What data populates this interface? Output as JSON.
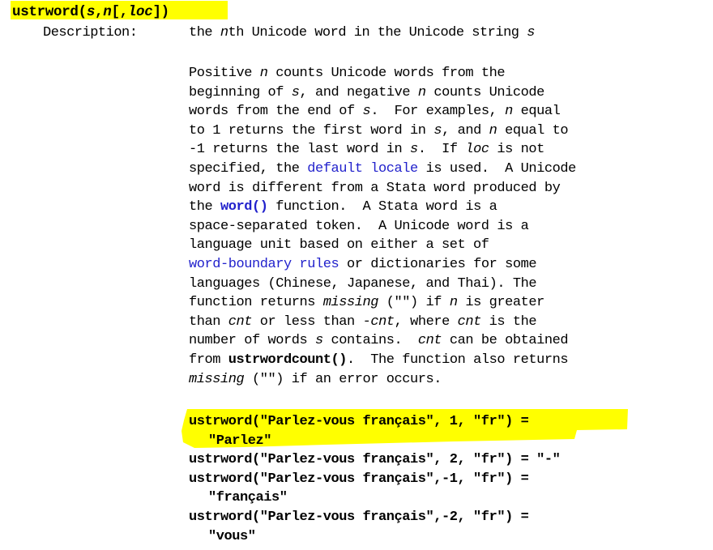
{
  "document": {
    "type": "stata-help-entry",
    "background_color": "#ffffff",
    "text_color": "#000000",
    "link_color": "#2222cc",
    "highlight_color": "#ffff00"
  },
  "signature": {
    "name": "ustrword",
    "full_text": "ustrword(s,n[,loc])",
    "parts": [
      {
        "text": "ustrword(",
        "style": "bold"
      },
      {
        "text": "s",
        "style": "bold-italic"
      },
      {
        "text": ",",
        "style": "bold"
      },
      {
        "text": "n",
        "style": "bold-italic"
      },
      {
        "text": "[,",
        "style": "bold"
      },
      {
        "text": "loc",
        "style": "bold-italic"
      },
      {
        "text": "])",
        "style": "bold"
      }
    ],
    "highlighted": true
  },
  "description": {
    "label": "Description:",
    "summary_parts": [
      {
        "text": "the ",
        "style": "plain"
      },
      {
        "text": "n",
        "style": "italic"
      },
      {
        "text": "th Unicode word in the Unicode string ",
        "style": "plain"
      },
      {
        "text": "s",
        "style": "italic"
      }
    ],
    "summary_plain": "the nth Unicode word in the Unicode string s"
  },
  "body": {
    "lines": [
      [
        {
          "text": "Positive ",
          "style": "plain"
        },
        {
          "text": "n",
          "style": "italic"
        },
        {
          "text": " counts Unicode words from the",
          "style": "plain"
        }
      ],
      [
        {
          "text": "beginning of ",
          "style": "plain"
        },
        {
          "text": "s",
          "style": "italic"
        },
        {
          "text": ", and negative ",
          "style": "plain"
        },
        {
          "text": "n",
          "style": "italic"
        },
        {
          "text": " counts Unicode",
          "style": "plain"
        }
      ],
      [
        {
          "text": "words from the end of ",
          "style": "plain"
        },
        {
          "text": "s",
          "style": "italic"
        },
        {
          "text": ".  For examples, ",
          "style": "plain"
        },
        {
          "text": "n",
          "style": "italic"
        },
        {
          "text": " equal",
          "style": "plain"
        }
      ],
      [
        {
          "text": "to 1 returns the first word in ",
          "style": "plain"
        },
        {
          "text": "s",
          "style": "italic"
        },
        {
          "text": ", and ",
          "style": "plain"
        },
        {
          "text": "n",
          "style": "italic"
        },
        {
          "text": " equal to",
          "style": "plain"
        }
      ],
      [
        {
          "text": "-1 returns the last word in ",
          "style": "plain"
        },
        {
          "text": "s",
          "style": "italic"
        },
        {
          "text": ".  If ",
          "style": "plain"
        },
        {
          "text": "loc",
          "style": "italic"
        },
        {
          "text": " is not",
          "style": "plain"
        }
      ],
      [
        {
          "text": "specified, the ",
          "style": "plain"
        },
        {
          "text": "default locale",
          "style": "link"
        },
        {
          "text": " is used.  A Unicode",
          "style": "plain"
        }
      ],
      [
        {
          "text": "word is different from a Stata word produced by",
          "style": "plain"
        }
      ],
      [
        {
          "text": "the ",
          "style": "plain"
        },
        {
          "text": "word()",
          "style": "link-bold"
        },
        {
          "text": " function.  A Stata word is a",
          "style": "plain"
        }
      ],
      [
        {
          "text": "space-separated token.  A Unicode word is a",
          "style": "plain"
        }
      ],
      [
        {
          "text": "language unit based on either a set of",
          "style": "plain"
        }
      ],
      [
        {
          "text": "word-boundary rules",
          "style": "link"
        },
        {
          "text": " or dictionaries for some",
          "style": "plain"
        }
      ],
      [
        {
          "text": "languages (Chinese, Japanese, and Thai). The",
          "style": "plain"
        }
      ],
      [
        {
          "text": "function returns ",
          "style": "plain"
        },
        {
          "text": "missing",
          "style": "italic"
        },
        {
          "text": " (\"\") if ",
          "style": "plain"
        },
        {
          "text": "n",
          "style": "italic"
        },
        {
          "text": " is greater",
          "style": "plain"
        }
      ],
      [
        {
          "text": "than ",
          "style": "plain"
        },
        {
          "text": "cnt",
          "style": "italic"
        },
        {
          "text": " or less than ",
          "style": "plain"
        },
        {
          "text": "-cnt",
          "style": "italic"
        },
        {
          "text": ", where ",
          "style": "plain"
        },
        {
          "text": "cnt",
          "style": "italic"
        },
        {
          "text": " is the",
          "style": "plain"
        }
      ],
      [
        {
          "text": "number of words ",
          "style": "plain"
        },
        {
          "text": "s",
          "style": "italic"
        },
        {
          "text": " contains.  ",
          "style": "plain"
        },
        {
          "text": "cnt",
          "style": "italic"
        },
        {
          "text": " can be obtained",
          "style": "plain"
        }
      ],
      [
        {
          "text": "from ",
          "style": "plain"
        },
        {
          "text": "ustrwordcount()",
          "style": "bold"
        },
        {
          "text": ".  The function also returns",
          "style": "plain"
        }
      ],
      [
        {
          "text": "missing",
          "style": "italic"
        },
        {
          "text": " (\"\") if an error occurs.",
          "style": "plain"
        }
      ]
    ]
  },
  "examples": [
    {
      "call": "ustrword(\"Parlez-vous français\", 1, \"fr\") =",
      "result": "\"Parlez\"",
      "highlighted": true
    },
    {
      "call": "ustrword(\"Parlez-vous français\", 2, \"fr\") = \"-\"",
      "result": "",
      "highlighted": false
    },
    {
      "call": "ustrword(\"Parlez-vous français\",-1, \"fr\") =",
      "result": "\"français\"",
      "highlighted": false
    },
    {
      "call": "ustrword(\"Parlez-vous français\",-2, \"fr\") =",
      "result": "\"vous\"",
      "highlighted": false
    }
  ]
}
